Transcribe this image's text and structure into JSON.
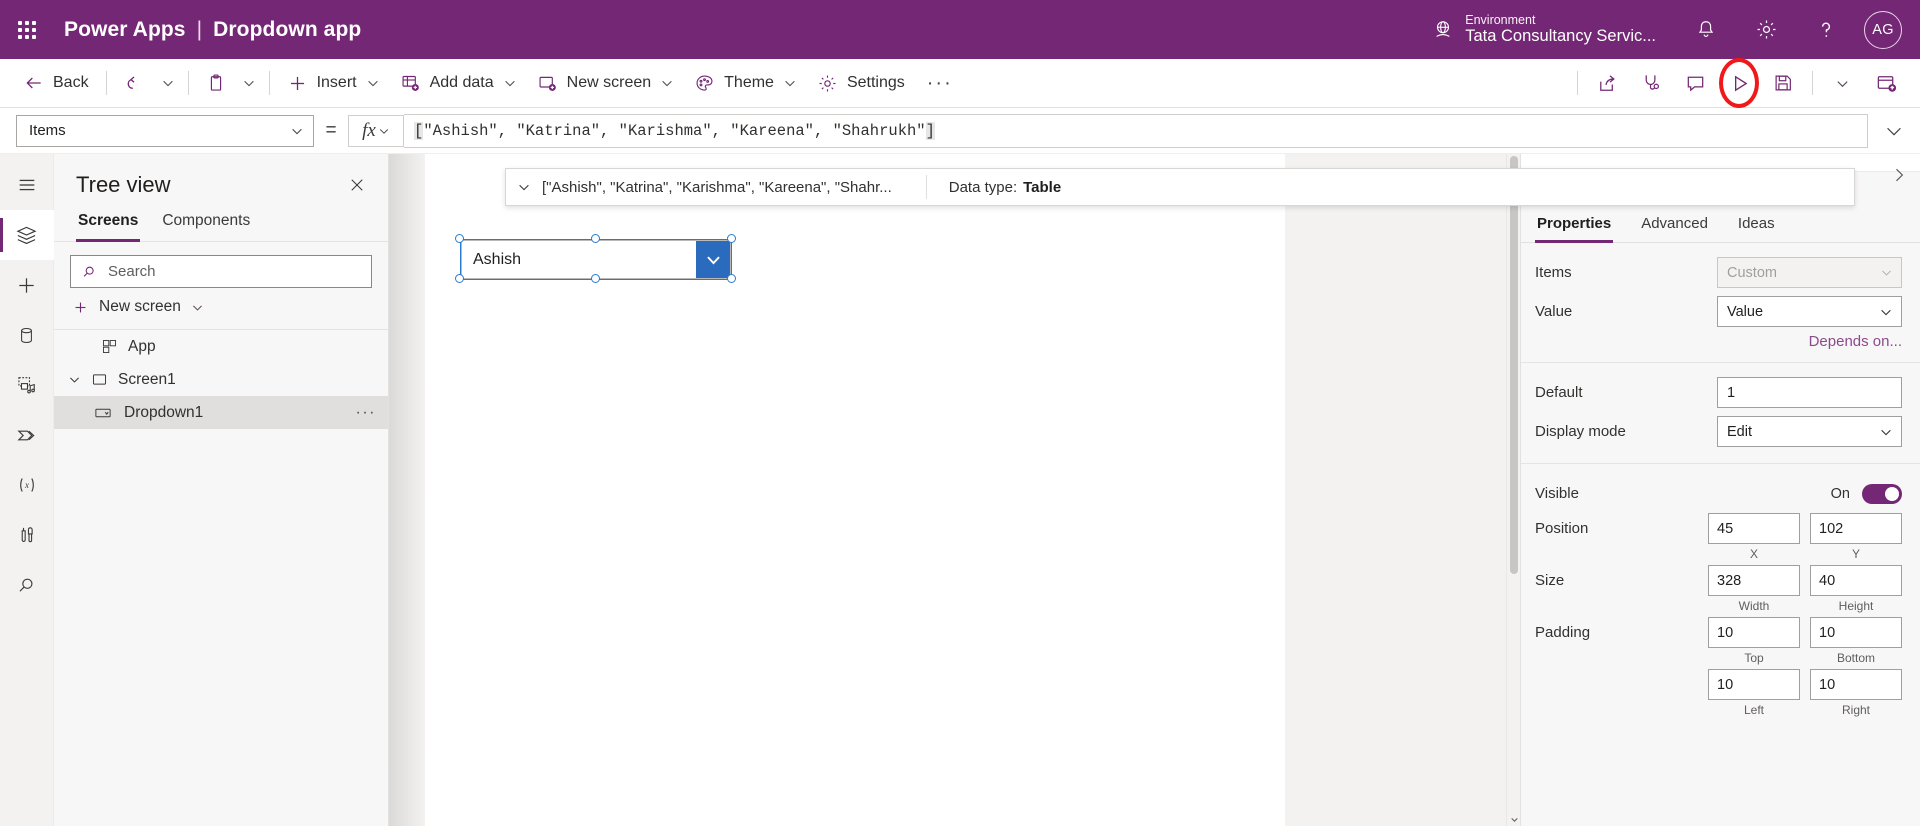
{
  "header": {
    "waffle_label": "app-launcher",
    "brand": "Power Apps",
    "separator": "|",
    "app_name": "Dropdown app",
    "environment_label": "Environment",
    "environment_name": "Tata Consultancy Servic...",
    "notifications_icon": "bell-icon",
    "settings_icon": "gear-icon",
    "help_icon": "question-mark-icon",
    "avatar_initials": "AG",
    "brand_color": "#742774"
  },
  "toolbar": {
    "back": "Back",
    "undo_icon": "undo-icon",
    "paste_icon": "clipboard-icon",
    "insert": "Insert",
    "add_data": "Add data",
    "new_screen": "New screen",
    "theme": "Theme",
    "settings": "Settings",
    "overflow": "···",
    "right_icons": [
      {
        "name": "share-icon",
        "label": "Share"
      },
      {
        "name": "app-checker-icon",
        "label": "App checker"
      },
      {
        "name": "comments-icon",
        "label": "Comments"
      },
      {
        "name": "play-preview-icon",
        "label": "Preview the app",
        "highlighted": true,
        "highlight_color": "#f01818"
      },
      {
        "name": "save-icon",
        "label": "Save"
      },
      {
        "name": "save-options-chevron-icon",
        "label": "Save options"
      },
      {
        "name": "publish-icon",
        "label": "Publish"
      }
    ]
  },
  "formula_bar": {
    "property": "Items",
    "equals": "=",
    "fx_label": "fx",
    "formula": "[\"Ashish\", \"Katrina\", \"Karishma\", \"Kareena\", \"Shahrukh\"]",
    "formula_open_bracket": "[",
    "formula_body": "\"Ashish\", \"Katrina\", \"Karishma\", \"Kareena\", \"Shahrukh\"",
    "formula_close_bracket": "]",
    "result_preview": "[\"Ashish\", \"Katrina\", \"Karishma\", \"Kareena\", \"Shahr...",
    "data_type_label": "Data type:",
    "data_type_value": "Table",
    "expand_icon": "chevron-down-icon"
  },
  "rail": {
    "items": [
      {
        "name": "hamburger-menu-icon",
        "label": "Menu",
        "active": false
      },
      {
        "name": "tree-view-icon",
        "label": "Tree view",
        "active": true
      },
      {
        "name": "insert-plus-icon",
        "label": "Insert",
        "active": false
      },
      {
        "name": "data-cylinder-icon",
        "label": "Data",
        "active": false
      },
      {
        "name": "media-icon",
        "label": "Media",
        "active": false
      },
      {
        "name": "power-automate-icon",
        "label": "Power Automate",
        "active": false
      },
      {
        "name": "variables-icon",
        "label": "Variables",
        "active": false
      },
      {
        "name": "tools-icon",
        "label": "Advanced tools",
        "active": false
      },
      {
        "name": "search-rail-icon",
        "label": "Search",
        "active": false
      }
    ]
  },
  "tree_panel": {
    "title": "Tree view",
    "close_icon": "close-icon",
    "tabs": [
      {
        "label": "Screens",
        "active": true
      },
      {
        "label": "Components",
        "active": false
      }
    ],
    "search_placeholder": "Search",
    "search_value": "",
    "search_icon": "search-icon",
    "new_screen": "New screen",
    "new_screen_icon": "plus-icon",
    "nodes": [
      {
        "label": "App",
        "icon": "app-icon",
        "level": 0,
        "selected": false,
        "expandable": false
      },
      {
        "label": "Screen1",
        "icon": "screen-icon",
        "level": 0,
        "selected": false,
        "expandable": true,
        "expanded": true
      },
      {
        "label": "Dropdown1",
        "icon": "dropdown-control-icon",
        "level": 1,
        "selected": true,
        "expandable": false,
        "more": "···"
      }
    ]
  },
  "canvas": {
    "dropdown_value": "Ashish",
    "dropdown_arrow_icon": "chevron-down-icon",
    "dropdown_accent_color": "#2a6bbd",
    "selection_color": "#2a7ad2"
  },
  "properties": {
    "control_name": "Dropdown1",
    "collapse_icon": "chevron-right-icon",
    "tabs": [
      {
        "label": "Properties",
        "active": true
      },
      {
        "label": "Advanced",
        "active": false
      },
      {
        "label": "Ideas",
        "active": false
      }
    ],
    "items_label": "Items",
    "items_value": "Custom",
    "value_label": "Value",
    "value_value": "Value",
    "depends_on": "Depends on...",
    "default_label": "Default",
    "default_value": "1",
    "display_mode_label": "Display mode",
    "display_mode_value": "Edit",
    "visible_label": "Visible",
    "visible_state": "On",
    "position_label": "Position",
    "position_x": "45",
    "position_y": "102",
    "position_x_caption": "X",
    "position_y_caption": "Y",
    "size_label": "Size",
    "size_width": "328",
    "size_height": "40",
    "size_width_caption": "Width",
    "size_height_caption": "Height",
    "padding_label": "Padding",
    "padding_top": "10",
    "padding_bottom": "10",
    "padding_left": "10",
    "padding_right": "10",
    "padding_top_caption": "Top",
    "padding_bottom_caption": "Bottom",
    "padding_left_caption": "Left",
    "padding_right_caption": "Right"
  }
}
